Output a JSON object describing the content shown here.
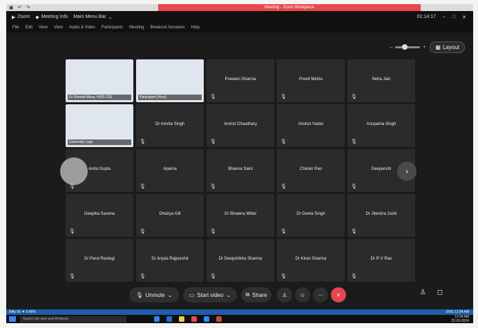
{
  "window": {
    "title": "Meeting - Zoom Workplace"
  },
  "menubar": {
    "app": "Zoom",
    "meeting_info": "Meeting Info",
    "main_menu": "Main Menu Bar",
    "timer": "01:14:17",
    "controls": [
      "–",
      "□",
      "✕"
    ]
  },
  "menu2": {
    "items": [
      "File",
      "Edit",
      "View",
      "View",
      "Audio & Video",
      "Participants",
      "Meeting",
      "Breakout Sessions",
      "Help"
    ]
  },
  "view": {
    "layout_label": "Layout",
    "zoom_minus": "–",
    "zoom_plus": "+"
  },
  "participants": [
    {
      "name": "Dr Sheetal Misra, HOD CSE",
      "video": true
    },
    {
      "name": "Participant (Host)",
      "video": true
    },
    {
      "name": "Praveen Sharma",
      "video": false
    },
    {
      "name": "Preeti Mehta",
      "video": false
    },
    {
      "name": "Neha Jain",
      "video": false
    },
    {
      "name": "University Logo",
      "video": true
    },
    {
      "name": "Dr Amrita Singh",
      "video": false
    },
    {
      "name": "Arvind Chaudhary",
      "video": false
    },
    {
      "name": "Anshul Yadav",
      "video": false
    },
    {
      "name": "Anupama Singh",
      "video": false
    },
    {
      "name": "Anita Gupta",
      "video": false
    },
    {
      "name": "Aparna",
      "video": false
    },
    {
      "name": "Bhavna Saini",
      "video": false
    },
    {
      "name": "Chetan Rao",
      "video": false
    },
    {
      "name": "Deepanshi",
      "video": false
    },
    {
      "name": "Deepika Saxena",
      "video": false
    },
    {
      "name": "Dhairya Gill",
      "video": false
    },
    {
      "name": "Dr Bhawna Mittal",
      "video": false
    },
    {
      "name": "Dr Geeta Singh",
      "video": false
    },
    {
      "name": "Dr Jitendra Joshi",
      "video": false
    },
    {
      "name": "Dr Parul Rastogi",
      "video": false
    },
    {
      "name": "Dr Anjula Rajpurohit",
      "video": false
    },
    {
      "name": "Dr Deepshikha Sharma",
      "video": false
    },
    {
      "name": "Dr Kiran Sharma",
      "video": false
    },
    {
      "name": "Dr R V Rao",
      "video": false
    }
  ],
  "toolbar": {
    "unmute": "Unmute",
    "start_video": "Start video",
    "share": "Share",
    "end": "✕"
  },
  "status": {
    "left": "Nifty 50 ▼ 0.46%",
    "right": "ENG 11:04 AM"
  },
  "taskbar": {
    "search_placeholder": "Search the web and Windows",
    "time": "11:04 AM",
    "date": "22-03-2024"
  },
  "colors": {
    "background": "#1b1b1b",
    "tile": "#2b2b2b",
    "end_button": "#e5484d",
    "status_bar": "#1d5ea8"
  }
}
